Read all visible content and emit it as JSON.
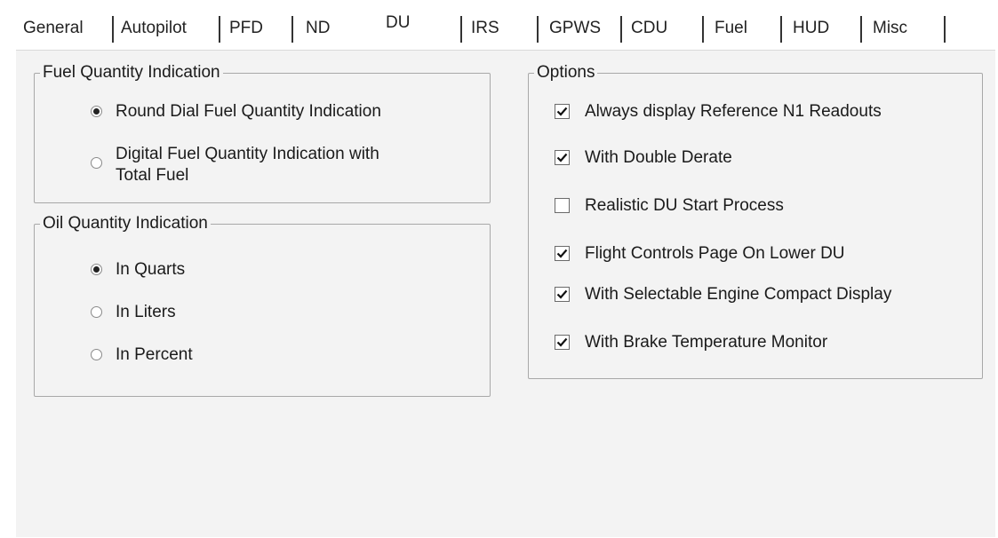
{
  "tabs": [
    {
      "label": "General",
      "active": false
    },
    {
      "label": "Autopilot",
      "active": false
    },
    {
      "label": "PFD",
      "active": false
    },
    {
      "label": "ND",
      "active": false
    },
    {
      "label": "DU",
      "active": true
    },
    {
      "label": "IRS",
      "active": false
    },
    {
      "label": "GPWS",
      "active": false
    },
    {
      "label": "CDU",
      "active": false
    },
    {
      "label": "Fuel",
      "active": false
    },
    {
      "label": "HUD",
      "active": false
    },
    {
      "label": "Misc",
      "active": false
    }
  ],
  "fuel_group": {
    "title": "Fuel Quantity Indication",
    "options": [
      {
        "label": "Round Dial Fuel Quantity Indication",
        "selected": true
      },
      {
        "label_line1": "Digital Fuel Quantity Indication with",
        "label_line2": "Total Fuel",
        "selected": false
      }
    ]
  },
  "oil_group": {
    "title": "Oil Quantity Indication",
    "options": [
      {
        "label": "In Quarts",
        "selected": true
      },
      {
        "label": "In Liters",
        "selected": false
      },
      {
        "label": "In Percent",
        "selected": false
      }
    ]
  },
  "options_group": {
    "title": "Options",
    "items": [
      {
        "label": "Always display Reference N1 Readouts",
        "checked": true
      },
      {
        "label": "With Double Derate",
        "checked": true
      },
      {
        "label": "Realistic DU Start Process",
        "checked": false
      },
      {
        "label": "Flight Controls Page On Lower DU",
        "checked": true
      },
      {
        "label": "With Selectable Engine Compact Display",
        "checked": true
      },
      {
        "label": "With Brake Temperature Monitor",
        "checked": true
      }
    ]
  }
}
